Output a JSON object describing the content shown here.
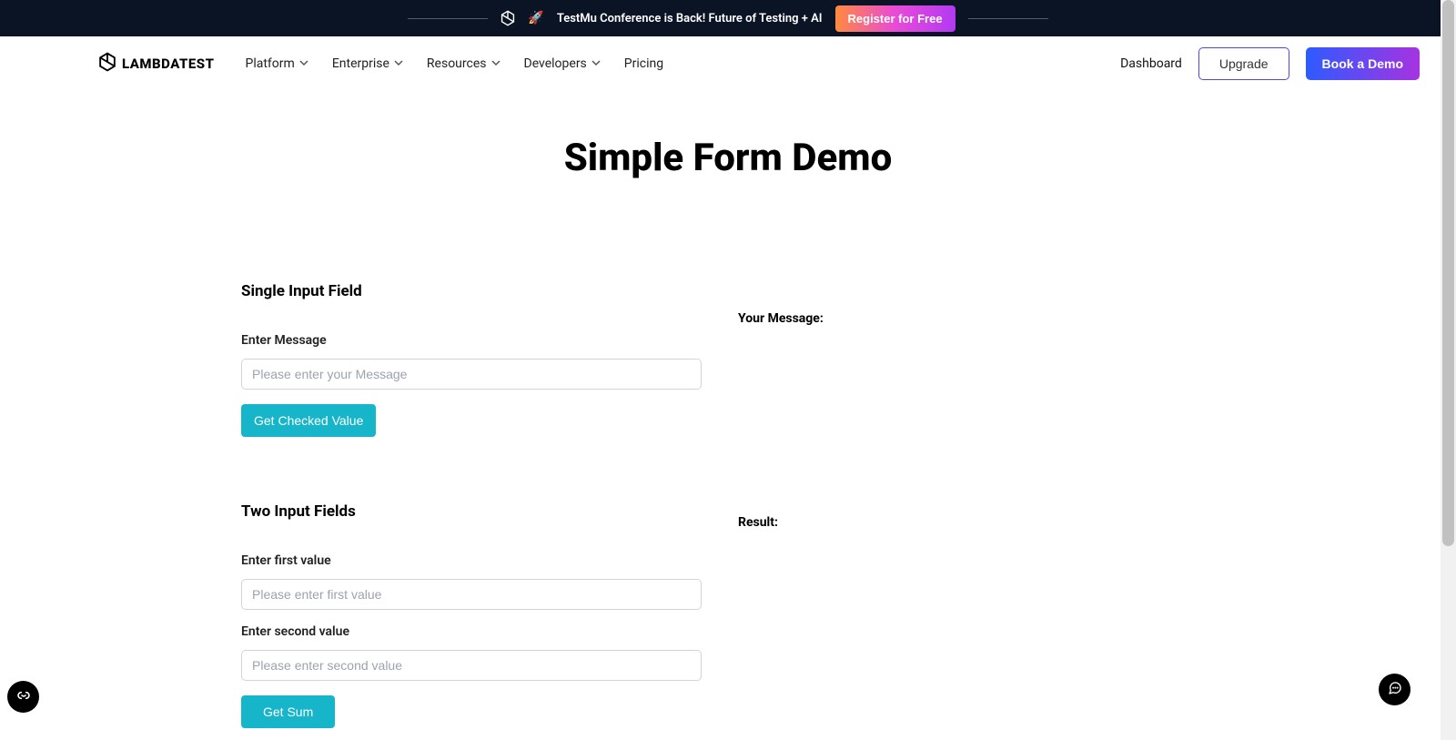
{
  "announce": {
    "text": "TestMu Conference is Back! Future of Testing + AI",
    "register_label": "Register for Free",
    "rocket": "🚀"
  },
  "brand": {
    "name": "LAMBDATEST"
  },
  "nav": {
    "items": [
      {
        "label": "Platform"
      },
      {
        "label": "Enterprise"
      },
      {
        "label": "Resources"
      },
      {
        "label": "Developers"
      },
      {
        "label": "Pricing"
      }
    ],
    "dashboard_label": "Dashboard",
    "upgrade_label": "Upgrade",
    "book_demo_label": "Book a Demo"
  },
  "page": {
    "title": "Simple Form Demo"
  },
  "single_input": {
    "heading": "Single Input Field",
    "label": "Enter Message",
    "placeholder": "Please enter your Message",
    "button_label": "Get Checked Value",
    "output_label": "Your Message:"
  },
  "two_input": {
    "heading": "Two Input Fields",
    "label1": "Enter first value",
    "placeholder1": "Please enter first value",
    "label2": "Enter second value",
    "placeholder2": "Please enter second value",
    "button_label": "Get Sum",
    "output_label": "Result:"
  }
}
